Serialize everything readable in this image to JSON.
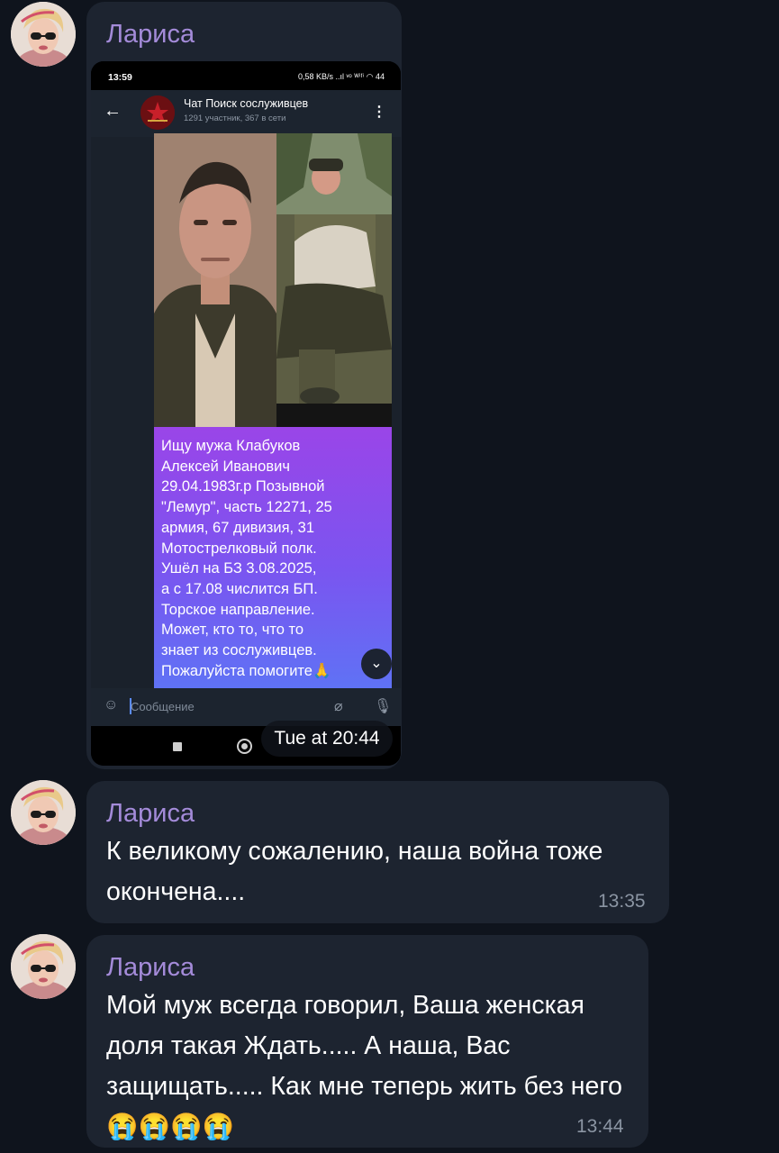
{
  "colors": {
    "background": "#0f141d",
    "bubble": "#1d2430",
    "sender_name": "#a48bd9",
    "time": "#8b95a3",
    "purple_card_top": "#9a45e8",
    "purple_card_bottom": "#5f72f5"
  },
  "messages": [
    {
      "sender": "Лариса",
      "type": "image",
      "time": "Tue at 20:44",
      "screenshot": {
        "status_time": "13:59",
        "status_icons": "0,58 KB/s ..ıl ᵛᵒ ᵂⁱᶠⁱ ◠ 44",
        "chat_title": "Чат Поиск сослуживцев",
        "chat_subtitle": "1291 участник, 367 в сети",
        "post_text": "Ищу  мужа Клабуков\nАлексей Иванович\n29.04.1983г.р Позывной\n\"Лемур\", часть 12271, 25\nармия, 67 дивизия, 31\nМотострелковый полк.\nУшёл на БЗ 3.08.2025,\nа с 17.08 числится БП.\nТорское направление.\nМожет, кто то, что то\nзнает из сослуживцев.\nПожалуйста помогите🙏",
        "input_placeholder": "Сообщение"
      }
    },
    {
      "sender": "Лариса",
      "type": "text",
      "text": "К великому сожалению, наша война тоже окончена....",
      "time": "13:35"
    },
    {
      "sender": "Лариса",
      "type": "text",
      "text": "Мой муж всегда говорил, Ваша женская доля такая Ждать..... А наша, Вас защищать..... Как мне теперь жить без него😭😭😭😭",
      "time": "13:44"
    }
  ],
  "icons": {
    "back": "arrow-left-icon",
    "menu": "more-vertical-icon",
    "emoji": "smile-icon",
    "attach": "paperclip-icon",
    "mic": "microphone-icon",
    "scroll_down": "chevron-down-icon"
  }
}
